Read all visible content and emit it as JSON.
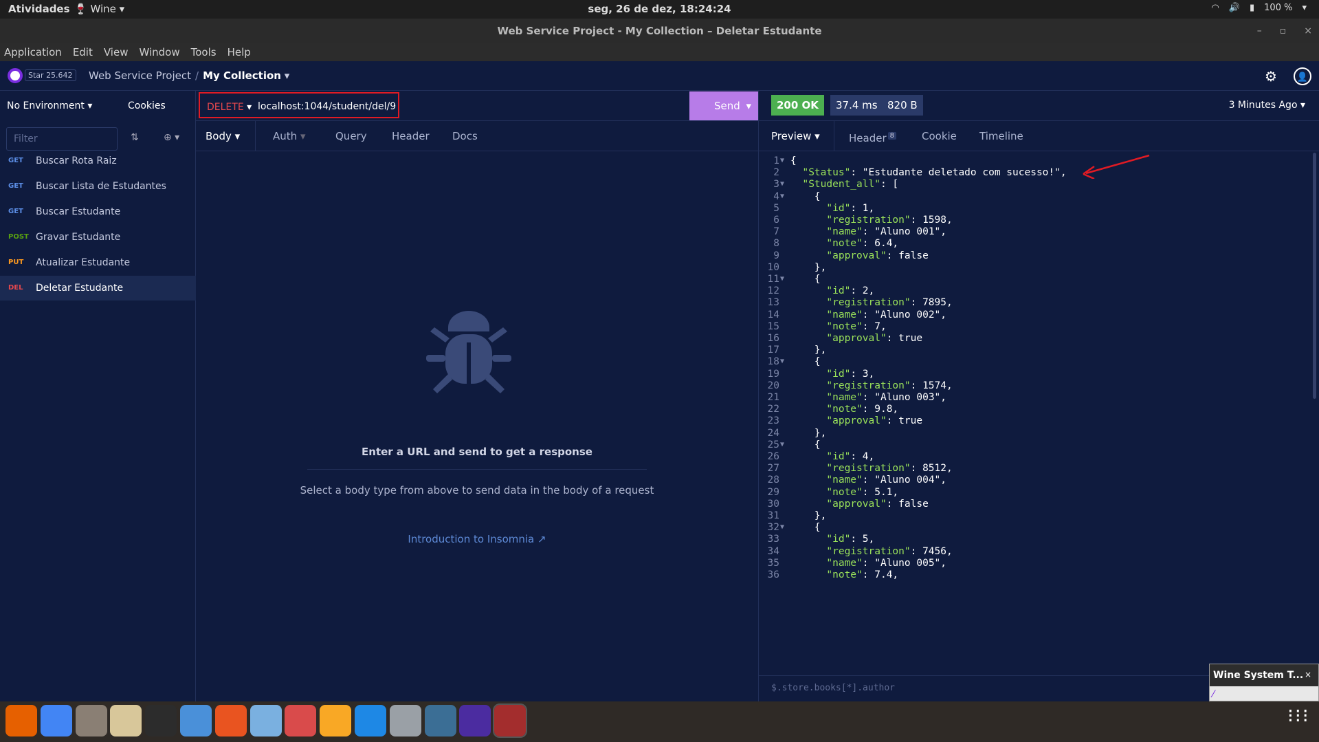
{
  "topbar": {
    "activities": "Atividades",
    "wine": "Wine",
    "clock": "seg, 26 de dez, 18:24:24",
    "battery": "100 %"
  },
  "titlebar": {
    "title": "Web Service Project - My Collection – Deletar Estudante"
  },
  "menu": [
    "Application",
    "Edit",
    "View",
    "Window",
    "Tools",
    "Help"
  ],
  "header": {
    "star_label": "Star",
    "star_count": "25.642",
    "workspace": "Web Service Project",
    "separator": "/",
    "collection": "My Collection"
  },
  "sidebar": {
    "environment": "No Environment",
    "cookies": "Cookies",
    "filter_placeholder": "Filter",
    "requests": [
      {
        "method": "GET",
        "name": "Buscar Rota Raiz",
        "color": "#5c8ee6"
      },
      {
        "method": "GET",
        "name": "Buscar Lista de Estudantes",
        "color": "#5c8ee6"
      },
      {
        "method": "GET",
        "name": "Buscar Estudante",
        "color": "#5c8ee6"
      },
      {
        "method": "POST",
        "name": "Gravar Estudante",
        "color": "#59a210"
      },
      {
        "method": "PUT",
        "name": "Atualizar Estudante",
        "color": "#ff9a1f"
      },
      {
        "method": "DEL",
        "name": "Deletar Estudante",
        "color": "#e5484d"
      }
    ]
  },
  "request": {
    "method": "DELETE",
    "url": "localhost:1044/student/del/9",
    "send": "Send",
    "tabs": [
      "Body",
      "Auth",
      "Query",
      "Header",
      "Docs"
    ],
    "empty_title": "Enter a URL and send to get a response",
    "empty_hint": "Select a body type from above to send data in the body of a request",
    "intro_link": "Introduction to Insomnia"
  },
  "response": {
    "status": "200 OK",
    "time": "37.4 ms",
    "size": "820 B",
    "ago": "3 Minutes Ago",
    "tabs": {
      "preview": "Preview",
      "header": "Header",
      "header_count": "8",
      "cookie": "Cookie",
      "timeline": "Timeline"
    },
    "jsonpath_placeholder": "$.store.books[*].author"
  },
  "body_lines": [
    "{",
    "  \"Status\": \"Estudante deletado com sucesso!\",",
    "  \"Student_all\": [",
    "    {",
    "      \"id\": 1,",
    "      \"registration\": 1598,",
    "      \"name\": \"Aluno 001\",",
    "      \"note\": 6.4,",
    "      \"approval\": false",
    "    },",
    "    {",
    "      \"id\": 2,",
    "      \"registration\": 7895,",
    "      \"name\": \"Aluno 002\",",
    "      \"note\": 7,",
    "      \"approval\": true",
    "    },",
    "    {",
    "      \"id\": 3,",
    "      \"registration\": 1574,",
    "      \"name\": \"Aluno 003\",",
    "      \"note\": 9.8,",
    "      \"approval\": true",
    "    },",
    "    {",
    "      \"id\": 4,",
    "      \"registration\": 8512,",
    "      \"name\": \"Aluno 004\",",
    "      \"note\": 5.1,",
    "      \"approval\": false",
    "    },",
    "    {",
    "      \"id\": 5,",
    "      \"registration\": 7456,",
    "      \"name\": \"Aluno 005\",",
    "      \"note\": 7.4,"
  ],
  "fold_lines": [
    1,
    3,
    4,
    11,
    18,
    25,
    32
  ],
  "wine_popup": "Wine System T...",
  "colors": {
    "accent": "#b77ce8",
    "ok": "#4caf50",
    "delete": "#e5484d",
    "annotation": "#e01b24"
  },
  "dock_icons": [
    "firefox-icon",
    "chrome-icon",
    "files-icon",
    "rhythmbox-icon",
    "terminal-icon",
    "help-icon",
    "software-icon",
    "document-viewer-icon",
    "evince-icon",
    "sublime-icon",
    "vscode-icon",
    "database-icon",
    "mysql-workbench-icon",
    "insomnia-icon",
    "wine-icon"
  ]
}
